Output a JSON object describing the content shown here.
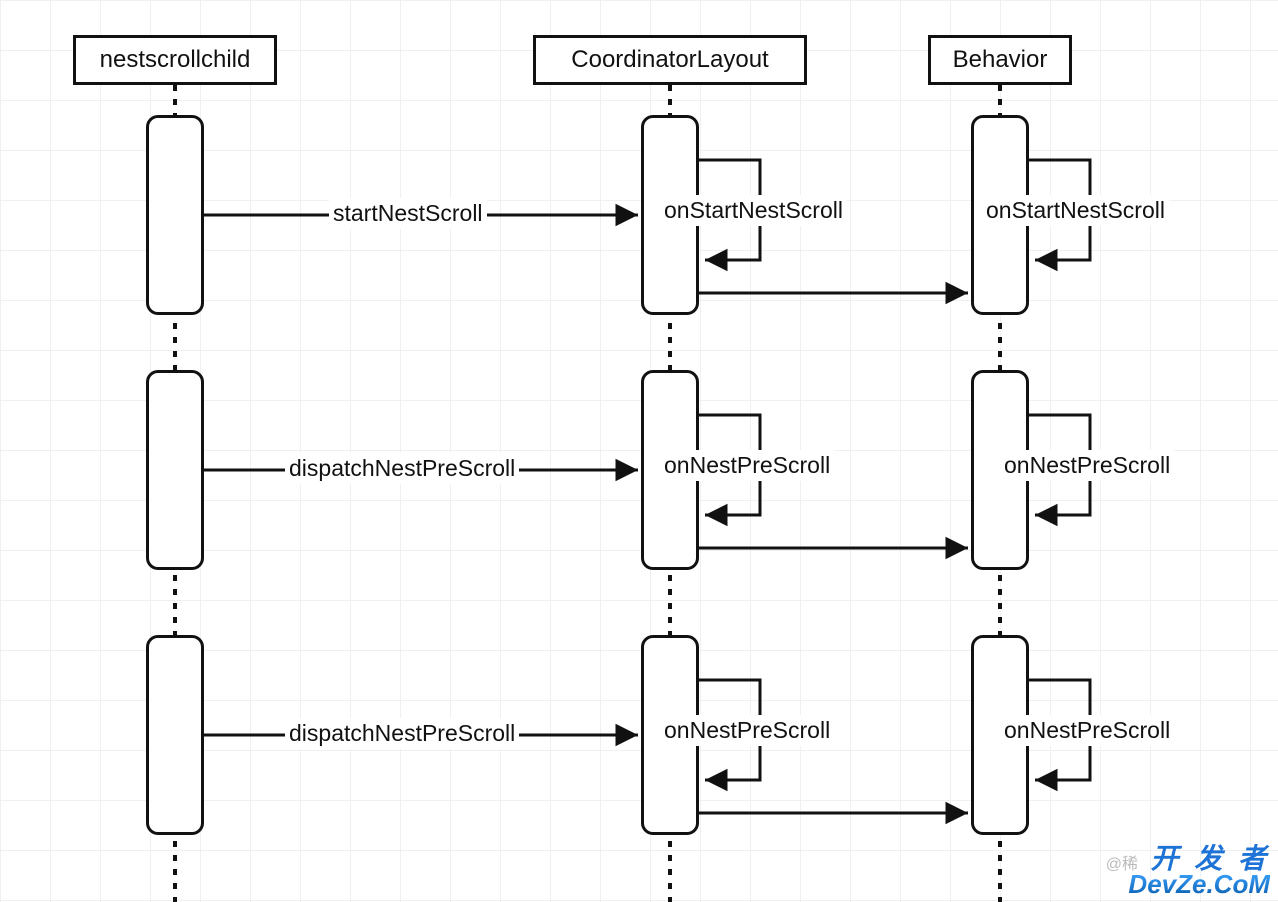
{
  "diagram": {
    "lifelines": {
      "child": "nestscrollchild",
      "coord": "CoordinatorLayout",
      "behavior": "Behavior"
    },
    "rows": [
      {
        "msg_child_to_coord": "startNestScroll",
        "self_coord": "onStartNestScroll",
        "self_behavior": "onStartNestScroll"
      },
      {
        "msg_child_to_coord": "dispatchNestPreScroll",
        "self_coord": "onNestPreScroll",
        "self_behavior": "onNestPreScroll"
      },
      {
        "msg_child_to_coord": "dispatchNestPreScroll",
        "self_coord": "onNestPreScroll",
        "self_behavior": "onNestPreScroll"
      }
    ]
  },
  "watermark": {
    "cn": "开 发 者",
    "en": "DevZe.CoM",
    "at": "@稀"
  }
}
